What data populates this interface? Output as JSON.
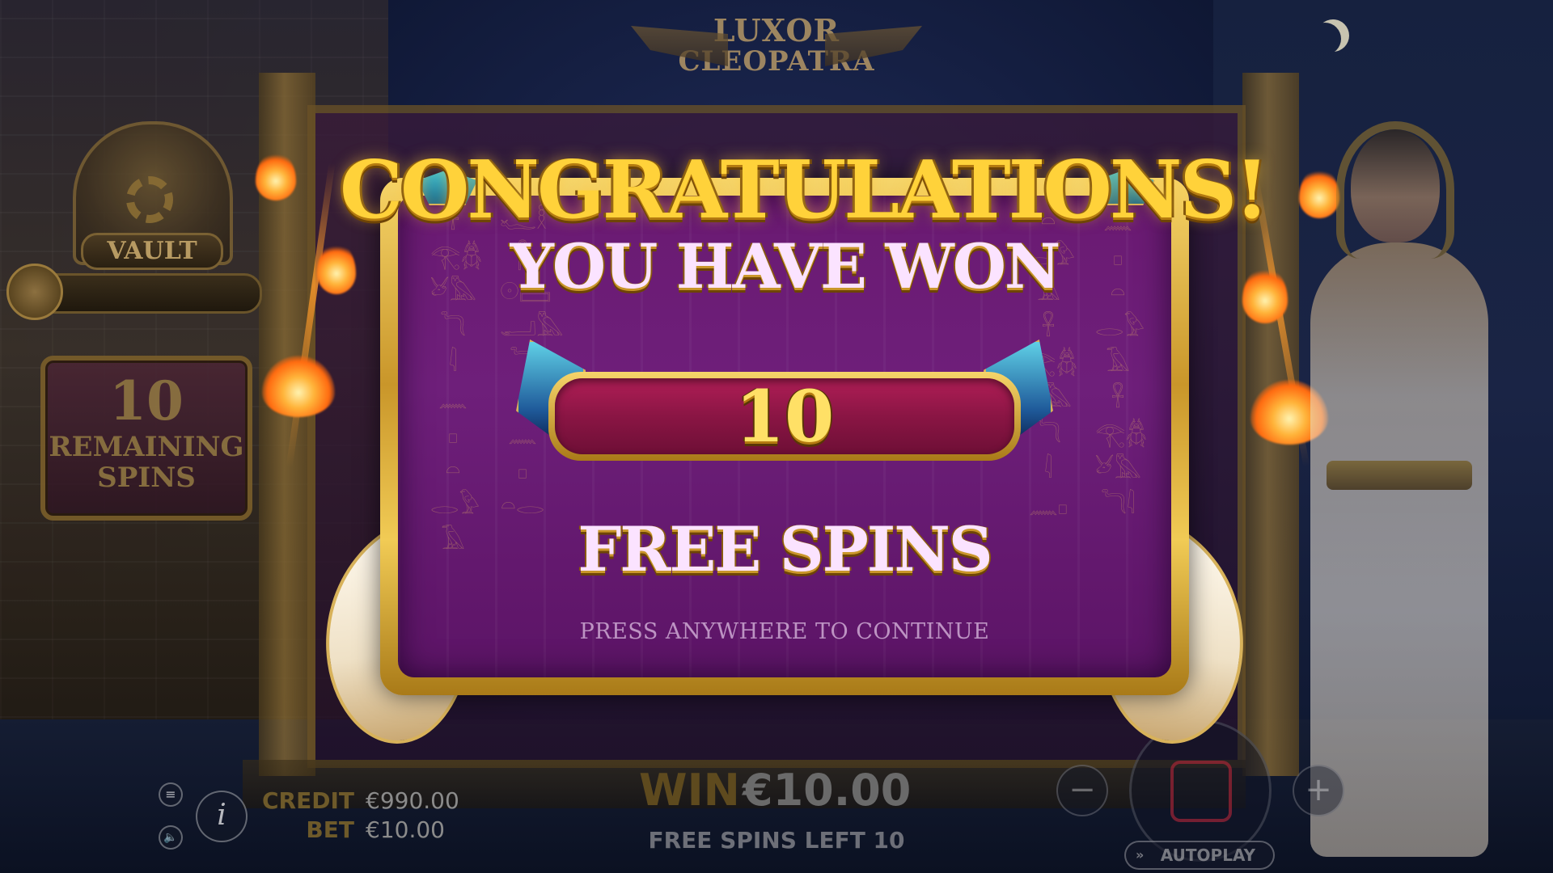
{
  "logo": {
    "line1": "LUXOR",
    "line2": "CLEOPATRA"
  },
  "vault": {
    "label": "VAULT"
  },
  "remaining_spins": {
    "count": "10",
    "label_line1": "REMAINING",
    "label_line2": "SPINS"
  },
  "popup": {
    "title": "CONGRATULATIONS!",
    "subtitle": "YOU HAVE WON",
    "amount": "10",
    "prize_label": "FREE SPINS",
    "continue_hint": "PRESS ANYWHERE TO CONTINUE"
  },
  "hud": {
    "credit_label": "CREDIT",
    "credit_value": "€990.00",
    "bet_label": "BET",
    "bet_value": "€10.00",
    "win_label": "WIN",
    "win_value": "€10.00",
    "free_spins_left": "FREE SPINS LEFT 10",
    "autoplay_label": "AUTOPLAY",
    "menu_icon": "≡",
    "sound_icon": "🔈",
    "info_icon": "i",
    "minus_icon": "−",
    "plus_icon": "+",
    "autoplay_icon": "»"
  },
  "colors": {
    "gold": "#ffd23a",
    "panel_purple": "#6a1a72",
    "amount_magenta": "#8a1544",
    "text_pink": "#fbe3ff"
  },
  "hieroglyphs": {
    "col1": "𓋹𓂀𓆣𓃾𓅓𓆓𓇋𓈖𓊪𓏏𓂋𓅱𓄿",
    "col2": "𓆑𓎛𓋴𓇳𓈙𓂝𓅓𓆓𓇋𓈖𓊪𓏏𓂋",
    "col3": "𓏏𓂋𓅱𓄿𓋹𓂀𓆣𓃾𓅓𓆓𓇋𓈖𓊪",
    "col4": "𓈖𓊪𓏏𓂋𓅱𓄿𓋹𓂀𓆣𓃾𓅓𓆓𓇋"
  }
}
